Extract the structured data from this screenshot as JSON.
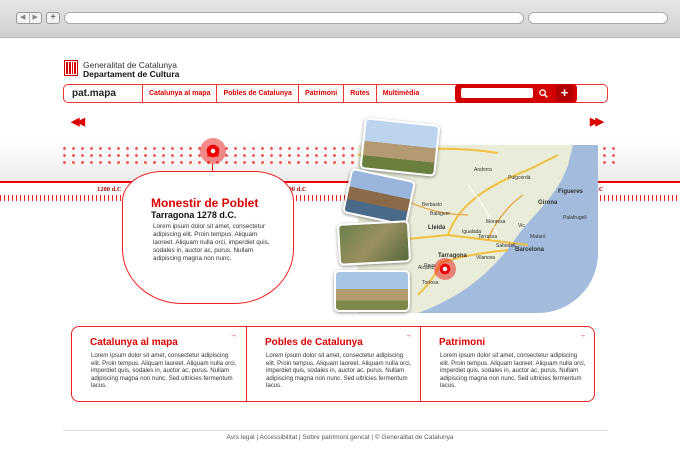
{
  "browser": {
    "nav_back": "◀",
    "nav_forward": "▶",
    "new_tab": "+"
  },
  "header": {
    "org_line1": "Generalitat de Catalunya",
    "org_line2": "Departament de Cultura"
  },
  "navbar": {
    "brand": "pat.mapa",
    "menu": [
      "Catalunya al mapa",
      "Pobles de Catalunya",
      "Patrimoni",
      "Rutes",
      "Multimèdia"
    ],
    "search_placeholder": "",
    "search_icon": "search-icon",
    "add_label": "+"
  },
  "timeline": {
    "left_arrow": "◀◀",
    "right_arrow": "▶▶",
    "years": [
      "1200 d.C",
      "1400 d.C",
      "1600 d.C"
    ]
  },
  "feature": {
    "title": "Monestir de Poblet",
    "subtitle": "Tarragona 1278 d.C.",
    "text": "Lorem ipsum dolor sit amet, consectetur adipiscing elit. Proin tempus. Aliquam laoreet. Aliquam nulla orci, imperdiet quis, sodales in, auctor ac, purus. Nullam adipiscing magna non nunc."
  },
  "map": {
    "labels": [
      "Andorra",
      "Puigcerdà",
      "Figueres",
      "Girona",
      "Lleida",
      "Manresa",
      "Vic",
      "Terrassa",
      "Sabadell",
      "Mataró",
      "Barcelona",
      "Tarragona",
      "Reus",
      "Tortosa",
      "Balaguer",
      "Igualada",
      "Vilanova",
      "Alcañiz",
      "Berbasto",
      "Palafrugell"
    ],
    "accent": "#e00000",
    "sea_color": "#9fb7d9"
  },
  "cards": [
    {
      "title": "Catalunya al mapa",
      "text": "Lorem ipsum dolor sit amet, consectetur adipiscing elit. Proin tempus. Aliquam laoreet. Aliquam nulla orci, imperdiet quis, sodales in, auctor ac, purus. Nullam adipiscing magna non nunc. Sed ultricies fermentum lacus.",
      "arrow": "→"
    },
    {
      "title": "Pobles de Catalunya",
      "text": "Lorem ipsum dolor sit amet, consectetur adipiscing elit. Proin tempus. Aliquam laoreet. Aliquam nulla orci, imperdiet quis, sodales in, auctor ac, purus. Nullam adipiscing magna non nunc. Sed ultricies fermentum lacus.",
      "arrow": "→"
    },
    {
      "title": "Patrimoni",
      "text": "Lorem ipsum dolor sit amet, consectetur adipiscing elit. Proin tempus. Aliquam laoreet. Aliquam nulla orci, imperdiet quis, sodales in, auctor ac, purus. Nullam adipiscing magna non nunc. Sed ultricies fermentum lacus.",
      "arrow": "→"
    }
  ],
  "footer": {
    "text": "Avís legal | Accessibilitat | Sobre patrimoni.gencat | © Generalitat de Catalunya"
  }
}
